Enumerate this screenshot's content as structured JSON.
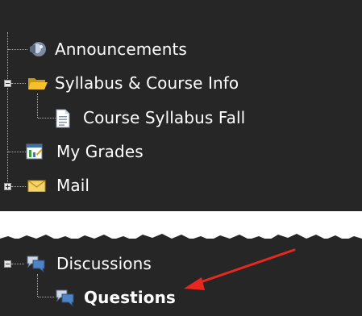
{
  "tree": {
    "items": [
      {
        "label": "Announcements"
      },
      {
        "label": "Syllabus & Course Info"
      },
      {
        "label": "Course Syllabus Fall"
      },
      {
        "label": "My Grades"
      },
      {
        "label": "Mail"
      },
      {
        "label": "Discussions"
      },
      {
        "label": "Questions"
      }
    ]
  },
  "colors": {
    "background": "#262626",
    "text": "#ffffff",
    "arrow": "#e8281e"
  },
  "icons": [
    "megaphone-icon",
    "folder-open-icon",
    "document-icon",
    "grades-icon",
    "envelope-icon",
    "discussion-icon",
    "discussion-icon"
  ]
}
